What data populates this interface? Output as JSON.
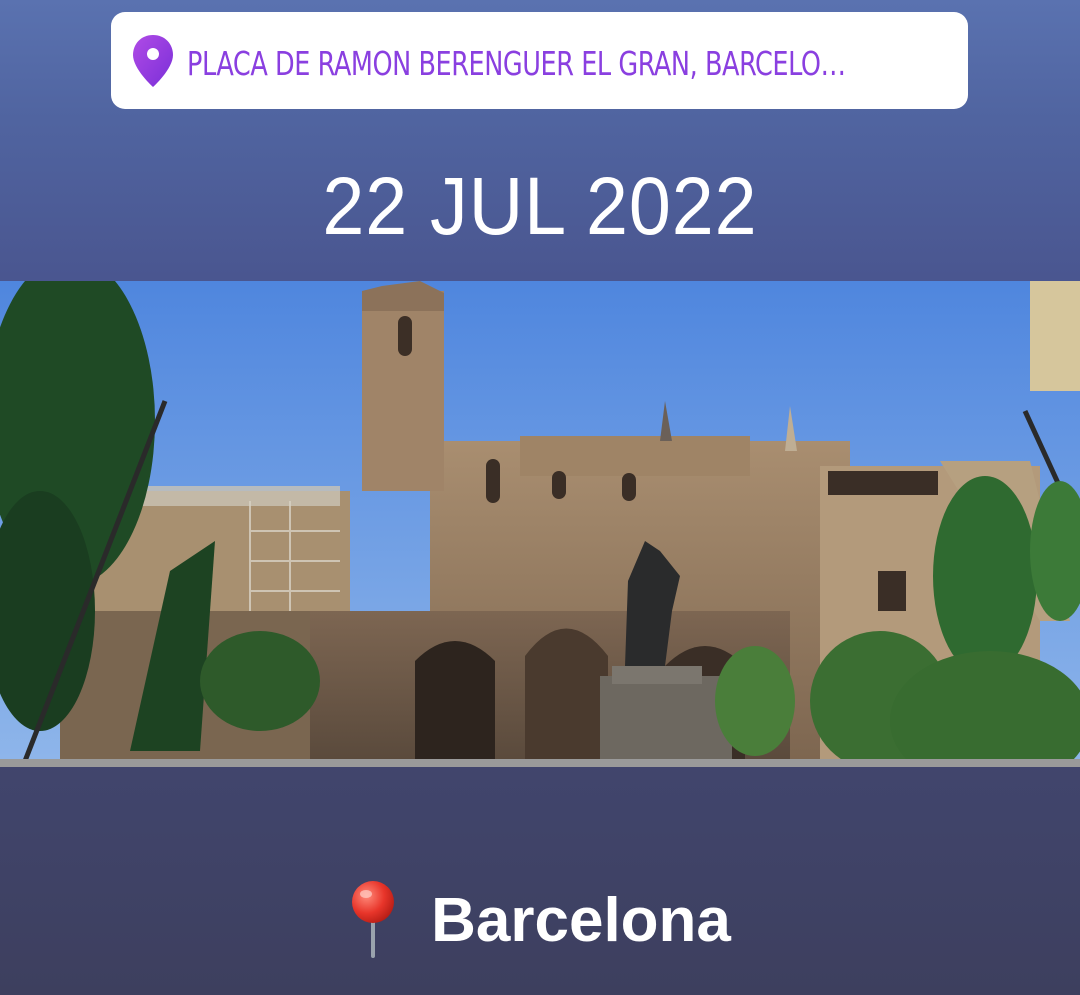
{
  "location_sticker": {
    "text": "PLACA DE RAMON BERENGUER EL GRAN, BARCELONA 巴塞...",
    "icon": "location-pin-icon",
    "text_color": "#8a3fe0"
  },
  "date": {
    "text": "22 JUL 2022"
  },
  "photo": {
    "subject": "barcelona-plaza-photo"
  },
  "caption": {
    "icon": "round-pushpin-icon",
    "text": "Barcelona"
  },
  "colors": {
    "background_top": "#5a72b0",
    "background_bottom": "#3d3f5e",
    "sticker_bg": "#ffffff",
    "text_light": "#ffffff"
  }
}
